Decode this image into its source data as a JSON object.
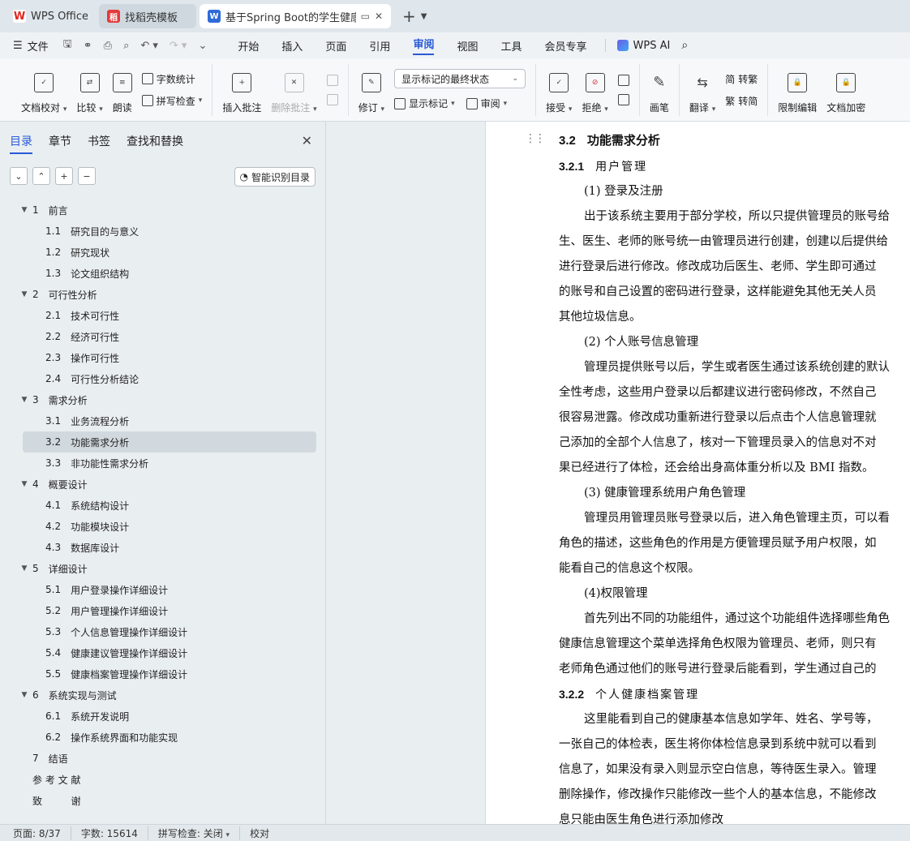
{
  "tabs": [
    {
      "label": "WPS Office"
    },
    {
      "label": "找稻壳模板"
    },
    {
      "label": "基于Spring Boot的学生健康管"
    }
  ],
  "menubar": {
    "file_label": "文件",
    "menus": [
      "开始",
      "插入",
      "页面",
      "引用",
      "审阅",
      "视图",
      "工具",
      "会员专享"
    ],
    "active_menu": "审阅",
    "ai_label": "WPS AI"
  },
  "ribbon": {
    "doc_check": "文档校对",
    "compare": "比较",
    "read_aloud": "朗读",
    "word_count": "字数统计",
    "spell_check": "拼写检查",
    "insert_comment": "插入批注",
    "delete_comment": "删除批注",
    "revise": "修订",
    "markup_select": "显示标记的最终状态",
    "show_markup": "显示标记",
    "review": "审阅",
    "accept": "接受",
    "reject": "拒绝",
    "pen": "画笔",
    "translate": "翻译",
    "to_traditional": "转繁",
    "to_simplified": "转简",
    "restrict_edit": "限制编辑",
    "doc_encrypt": "文档加密"
  },
  "sidebar": {
    "tabs": [
      "目录",
      "章节",
      "书签",
      "查找和替换"
    ],
    "smart_btn": "智能识别目录",
    "toc": [
      {
        "level": 1,
        "num": "1",
        "label": "前言"
      },
      {
        "level": 2,
        "num": "1.1",
        "label": "研究目的与意义"
      },
      {
        "level": 2,
        "num": "1.2",
        "label": "研究现状"
      },
      {
        "level": 2,
        "num": "1.3",
        "label": "论文组织结构"
      },
      {
        "level": 1,
        "num": "2",
        "label": "可行性分析"
      },
      {
        "level": 2,
        "num": "2.1",
        "label": "技术可行性"
      },
      {
        "level": 2,
        "num": "2.2",
        "label": "经济可行性"
      },
      {
        "level": 2,
        "num": "2.3",
        "label": "操作可行性"
      },
      {
        "level": 2,
        "num": "2.4",
        "label": "可行性分析结论"
      },
      {
        "level": 1,
        "num": "3",
        "label": "需求分析"
      },
      {
        "level": 2,
        "num": "3.1",
        "label": "业务流程分析"
      },
      {
        "level": 2,
        "num": "3.2",
        "label": "功能需求分析",
        "selected": true
      },
      {
        "level": 2,
        "num": "3.3",
        "label": "非功能性需求分析"
      },
      {
        "level": 1,
        "num": "4",
        "label": "概要设计"
      },
      {
        "level": 2,
        "num": "4.1",
        "label": "系统结构设计"
      },
      {
        "level": 2,
        "num": "4.2",
        "label": "功能模块设计"
      },
      {
        "level": 2,
        "num": "4.3",
        "label": "数据库设计"
      },
      {
        "level": 1,
        "num": "5",
        "label": "详细设计"
      },
      {
        "level": 2,
        "num": "5.1",
        "label": "用户登录操作详细设计"
      },
      {
        "level": 2,
        "num": "5.2",
        "label": "用户管理操作详细设计"
      },
      {
        "level": 2,
        "num": "5.3",
        "label": "个人信息管理操作详细设计"
      },
      {
        "level": 2,
        "num": "5.4",
        "label": "健康建议管理操作详细设计"
      },
      {
        "level": 2,
        "num": "5.5",
        "label": "健康档案管理操作详细设计"
      },
      {
        "level": 1,
        "num": "6",
        "label": "系统实现与测试"
      },
      {
        "level": 2,
        "num": "6.1",
        "label": "系统开发说明"
      },
      {
        "level": 2,
        "num": "6.2",
        "label": "操作系统界面和功能实现"
      },
      {
        "level": 0,
        "num": "7",
        "label": "结语"
      },
      {
        "level": 0,
        "num": "",
        "label": "参 考 文 献"
      },
      {
        "level": 0,
        "num": "",
        "label": "致 　 　 谢"
      }
    ]
  },
  "document": {
    "lines": [
      {
        "type": "h2",
        "num": "3.2",
        "text": "功能需求分析"
      },
      {
        "type": "h3",
        "num": "3.2.1",
        "text": "用户管理"
      },
      {
        "type": "ind",
        "text": "(1) 登录及注册"
      },
      {
        "type": "ind",
        "text": "出于该系统主要用于部分学校，所以只提供管理员的账号给"
      },
      {
        "type": "p",
        "text": "生、医生、老师的账号统一由管理员进行创建，创建以后提供给"
      },
      {
        "type": "p",
        "text": "进行登录后进行修改。修改成功后医生、老师、学生即可通过"
      },
      {
        "type": "p",
        "text": "的账号和自己设置的密码进行登录，这样能避免其他无关人员"
      },
      {
        "type": "p",
        "text": "其他垃圾信息。"
      },
      {
        "type": "ind",
        "text": "(2) 个人账号信息管理"
      },
      {
        "type": "ind",
        "text": "管理员提供账号以后，学生或者医生通过该系统创建的默认"
      },
      {
        "type": "p",
        "text": "全性考虑，这些用户登录以后都建议进行密码修改，不然自己"
      },
      {
        "type": "p",
        "text": "很容易泄露。修改成功重新进行登录以后点击个人信息管理就"
      },
      {
        "type": "p",
        "text": "己添加的全部个人信息了，核对一下管理员录入的信息对不对"
      },
      {
        "type": "p",
        "text": "果已经进行了体检，还会给出身高体重分析以及 BMI 指数。"
      },
      {
        "type": "ind",
        "text": "(3) 健康管理系统用户角色管理"
      },
      {
        "type": "ind",
        "text": "管理员用管理员账号登录以后，进入角色管理主页，可以看"
      },
      {
        "type": "p",
        "text": "角色的描述，这些角色的作用是方便管理员赋予用户权限，如"
      },
      {
        "type": "p",
        "text": "能看自己的信息这个权限。"
      },
      {
        "type": "ind",
        "text": "(4)权限管理"
      },
      {
        "type": "ind",
        "text": "首先列出不同的功能组件，通过这个功能组件选择哪些角色"
      },
      {
        "type": "p",
        "text": "健康信息管理这个菜单选择角色权限为管理员、老师，则只有"
      },
      {
        "type": "p",
        "text": "老师角色通过他们的账号进行登录后能看到，学生通过自己的"
      },
      {
        "type": "h3",
        "num": "3.2.2",
        "text": "个人健康档案管理"
      },
      {
        "type": "ind",
        "text": "这里能看到自己的健康基本信息如学年、姓名、学号等，"
      },
      {
        "type": "p",
        "text": "一张自己的体检表，医生将你体检信息录到系统中就可以看到"
      },
      {
        "type": "p",
        "text": "信息了，如果没有录入则显示空白信息，等待医生录入。管理"
      },
      {
        "type": "p",
        "text": "删除操作，修改操作只能修改一些个人的基本信息，不能修改"
      },
      {
        "type": "p",
        "text": "息只能由医生角色进行添加修改"
      }
    ]
  },
  "status": {
    "page": "页面: 8/37",
    "words": "字数: 15614",
    "spell": "拼写检查: 关闭",
    "proof": "校对"
  }
}
